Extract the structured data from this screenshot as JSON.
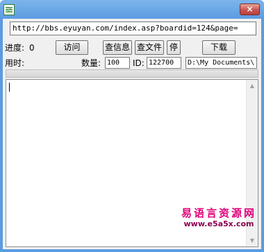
{
  "window": {
    "close_glyph": "×",
    "titlebar_color": "#5a9ae0",
    "close_color": "#c75050"
  },
  "toolbar": {
    "url_value": "http://bbs.eyuyan.com/index.asp?boardid=124&page=",
    "progress_label": "进度:",
    "progress_value": "0",
    "visit_button": "访问",
    "check_info_button": "查信息",
    "check_file_button": "查文件",
    "stop_button": "停",
    "download_button": "下载",
    "time_label": "用时:",
    "count_label": "数量:",
    "count_value": "100",
    "id_label": "ID:",
    "id_value": "122700",
    "path_value": "D:\\My Documents\\"
  },
  "progress_bar": {
    "fraction": 0
  },
  "log": {
    "text": ""
  },
  "watermark": {
    "site_name": "易语言资源网",
    "site_url": "www.e5a5x.com",
    "color": "#e0007a"
  },
  "icons": {
    "app": "app-icon",
    "close": "close-icon",
    "scroll_up": "scroll-up-arrow-icon",
    "scroll_down": "scroll-down-arrow-icon"
  }
}
